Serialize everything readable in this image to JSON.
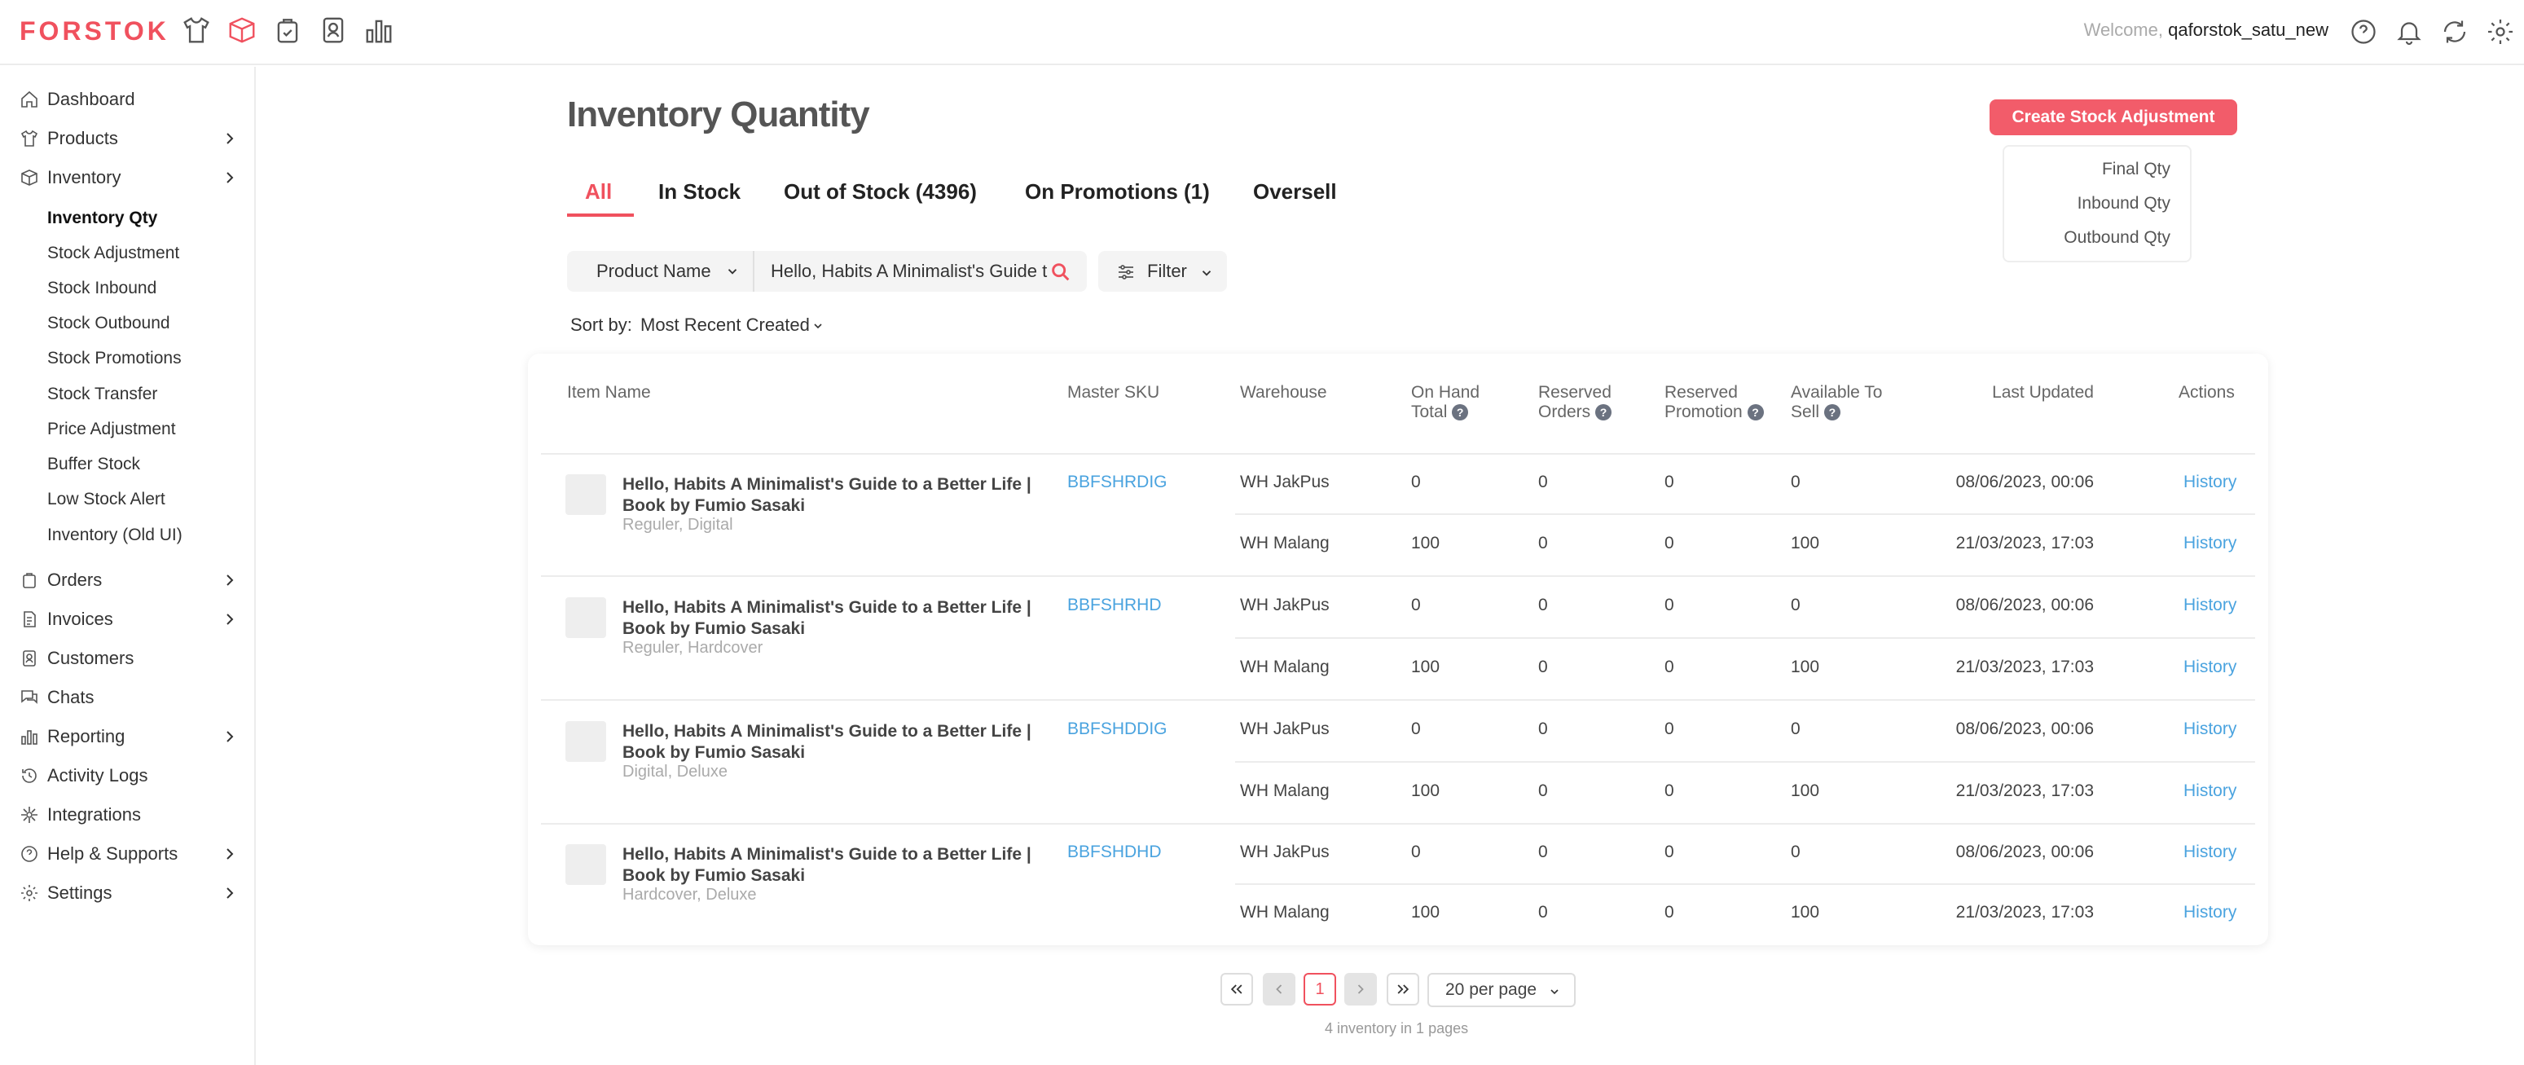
{
  "brand": {
    "logo": "FORSTOK",
    "accent": "#f0515e",
    "link": "#4aa3df"
  },
  "topbar": {
    "welcome_prefix": "Welcome, ",
    "username": "qaforstok_satu_new",
    "icons": [
      "shirt-icon",
      "box-icon",
      "bag-icon",
      "contacts-icon",
      "chart-icon"
    ],
    "right_icons": [
      "help-icon",
      "bell-icon",
      "sync-icon",
      "gear-icon"
    ]
  },
  "sidebar": {
    "items": [
      {
        "label": "Dashboard",
        "icon": "home-icon"
      },
      {
        "label": "Products",
        "icon": "shirt-icon",
        "expandable": true
      },
      {
        "label": "Inventory",
        "icon": "box-icon",
        "expandable": true
      },
      {
        "label": "Orders",
        "icon": "bag-icon",
        "expandable": true
      },
      {
        "label": "Invoices",
        "icon": "invoice-icon",
        "expandable": true
      },
      {
        "label": "Customers",
        "icon": "contacts-icon"
      },
      {
        "label": "Chats",
        "icon": "chat-icon"
      },
      {
        "label": "Reporting",
        "icon": "chart-icon",
        "expandable": true
      },
      {
        "label": "Activity Logs",
        "icon": "history-icon"
      },
      {
        "label": "Integrations",
        "icon": "integration-icon"
      },
      {
        "label": "Help & Supports",
        "icon": "help-icon",
        "expandable": true
      },
      {
        "label": "Settings",
        "icon": "gear-icon",
        "expandable": true
      }
    ],
    "inventory_sub": [
      "Inventory Qty",
      "Stock Adjustment",
      "Stock Inbound",
      "Stock Outbound",
      "Stock Promotions",
      "Stock Transfer",
      "Price Adjustment",
      "Buffer Stock",
      "Low Stock Alert",
      "Inventory (Old UI)"
    ]
  },
  "main": {
    "title": "Inventory Quantity",
    "create_button": "Create Stock Adjustment",
    "qty_menu": [
      "Final Qty",
      "Inbound Qty",
      "Outbound Qty"
    ],
    "tabs": [
      "All",
      "In Stock",
      "Out of Stock (4396)",
      "On Promotions (1)",
      "Oversell"
    ],
    "search": {
      "field": "Product Name",
      "value": "Hello, Habits A Minimalist's Guide t"
    },
    "filter_label": "Filter",
    "sort_label": "Sort by:",
    "sort_value": "Most Recent Created"
  },
  "table": {
    "headers": {
      "item_name": "Item Name",
      "master_sku": "Master SKU",
      "warehouse": "Warehouse",
      "on_hand_1": "On Hand",
      "on_hand_2": "Total",
      "reserved_orders_1": "Reserved",
      "reserved_orders_2": "Orders",
      "reserved_promo_1": "Reserved",
      "reserved_promo_2": "Promotion",
      "available_1": "Available To",
      "available_2": "Sell",
      "last_updated": "Last Updated",
      "actions": "Actions"
    },
    "rows": [
      {
        "name": "Hello, Habits A Minimalist's Guide to a Better Life | Book by Fumio Sasaki",
        "variant": "Reguler, Digital",
        "sku": "BBFSHRDIG",
        "stock": [
          {
            "warehouse": "WH JakPus",
            "on_hand": "0",
            "reserved_orders": "0",
            "reserved_promo": "0",
            "available": "0",
            "updated": "08/06/2023, 00:06",
            "action": "History"
          },
          {
            "warehouse": "WH Malang",
            "on_hand": "100",
            "reserved_orders": "0",
            "reserved_promo": "0",
            "available": "100",
            "updated": "21/03/2023, 17:03",
            "action": "History"
          }
        ]
      },
      {
        "name": "Hello, Habits A Minimalist's Guide to a Better Life | Book by Fumio Sasaki",
        "variant": "Reguler, Hardcover",
        "sku": "BBFSHRHD",
        "stock": [
          {
            "warehouse": "WH JakPus",
            "on_hand": "0",
            "reserved_orders": "0",
            "reserved_promo": "0",
            "available": "0",
            "updated": "08/06/2023, 00:06",
            "action": "History"
          },
          {
            "warehouse": "WH Malang",
            "on_hand": "100",
            "reserved_orders": "0",
            "reserved_promo": "0",
            "available": "100",
            "updated": "21/03/2023, 17:03",
            "action": "History"
          }
        ]
      },
      {
        "name": "Hello, Habits A Minimalist's Guide to a Better Life | Book by Fumio Sasaki",
        "variant": "Digital, Deluxe",
        "sku": "BBFSHDDIG",
        "stock": [
          {
            "warehouse": "WH JakPus",
            "on_hand": "0",
            "reserved_orders": "0",
            "reserved_promo": "0",
            "available": "0",
            "updated": "08/06/2023, 00:06",
            "action": "History"
          },
          {
            "warehouse": "WH Malang",
            "on_hand": "100",
            "reserved_orders": "0",
            "reserved_promo": "0",
            "available": "100",
            "updated": "21/03/2023, 17:03",
            "action": "History"
          }
        ]
      },
      {
        "name": "Hello, Habits A Minimalist's Guide to a Better Life | Book by Fumio Sasaki",
        "variant": "Hardcover, Deluxe",
        "sku": "BBFSHDHD",
        "stock": [
          {
            "warehouse": "WH JakPus",
            "on_hand": "0",
            "reserved_orders": "0",
            "reserved_promo": "0",
            "available": "0",
            "updated": "08/06/2023, 00:06",
            "action": "History"
          },
          {
            "warehouse": "WH Malang",
            "on_hand": "100",
            "reserved_orders": "0",
            "reserved_promo": "0",
            "available": "100",
            "updated": "21/03/2023, 17:03",
            "action": "History"
          }
        ]
      }
    ]
  },
  "pagination": {
    "current": "1",
    "per_page": "20 per page",
    "info": "4 inventory in 1 pages"
  }
}
